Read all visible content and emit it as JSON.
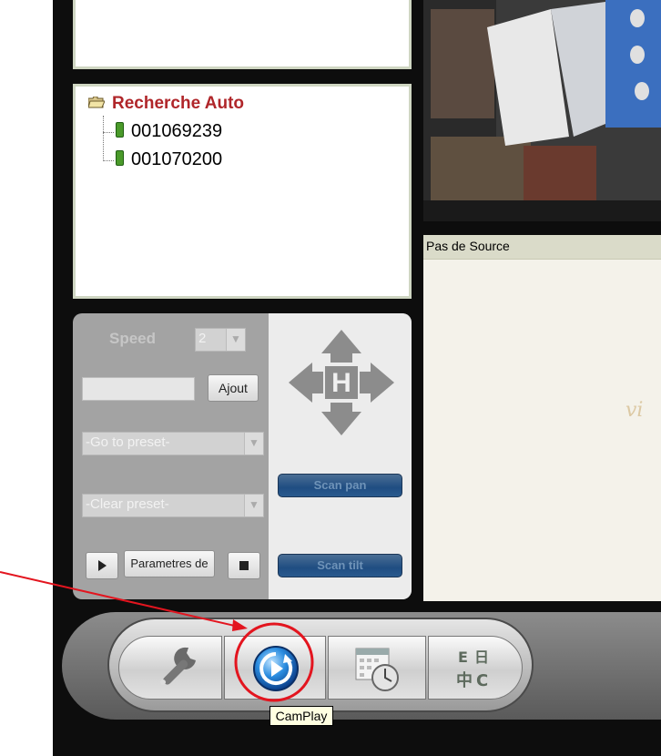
{
  "tree": {
    "root_label": "Recherche Auto",
    "devices": [
      "001069239",
      "001070200"
    ]
  },
  "ptz": {
    "speed_label": "Speed",
    "speed_value": "2",
    "preset_name_value": "",
    "add_button": "Ajout",
    "go_to_preset": "-Go to preset-",
    "clear_preset": "-Clear preset-",
    "params_label": "Parametres de",
    "scan_pan": "Scan pan",
    "scan_tilt": "Scan tilt"
  },
  "video": {
    "no_source_label": "Pas de Source",
    "watermark": "vi"
  },
  "toolbar": {
    "tooltip": "CamPlay",
    "icons": [
      "wrench-icon",
      "camplay-icon",
      "calendar-clock-icon",
      "language-icon"
    ]
  },
  "colors": {
    "root_text": "#b0262a",
    "highlight_circle": "#e3151f",
    "arrow": "#e3151f"
  }
}
